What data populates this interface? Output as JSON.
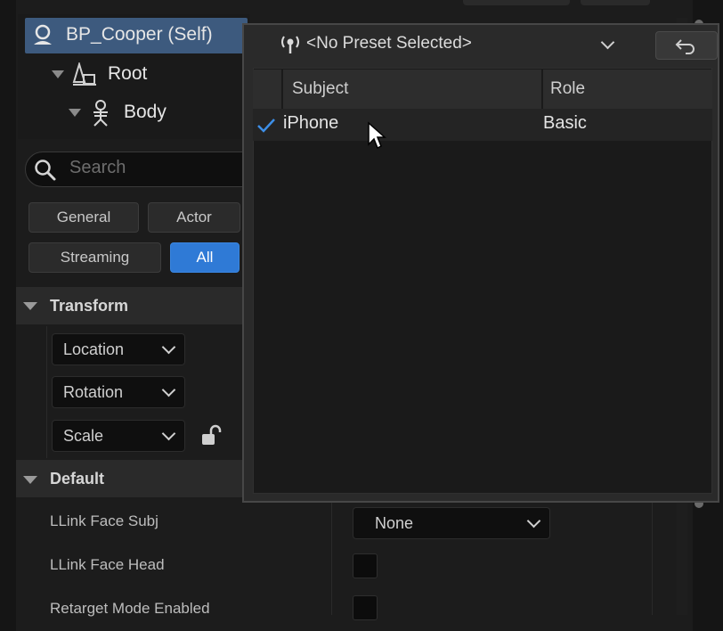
{
  "outliner": {
    "self_item": "BP_Cooper (Self)",
    "root_item": "Root",
    "body_item": "Body"
  },
  "search": {
    "placeholder": "Search"
  },
  "filters": [
    {
      "label": "General",
      "active": false
    },
    {
      "label": "Actor",
      "active": false
    },
    {
      "label": "Streaming",
      "active": false
    },
    {
      "label": "All",
      "active": true
    }
  ],
  "transform": {
    "header": "Transform",
    "location_label": "Location",
    "rotation_label": "Rotation",
    "scale_label": "Scale"
  },
  "default_section": {
    "header": "Default",
    "properties": [
      {
        "label": "LLink Face Subj",
        "value": "None"
      },
      {
        "label": "LLink Face Head",
        "value": ""
      },
      {
        "label": "Retarget Mode Enabled",
        "value": ""
      }
    ]
  },
  "popup": {
    "preset": "<No Preset Selected>",
    "columns": {
      "subject": "Subject",
      "role": "Role"
    },
    "rows": [
      {
        "subject": "iPhone",
        "role": "Basic",
        "checked": true
      }
    ]
  },
  "colors": {
    "selection": "#3d5a7e",
    "accent": "#2f7ad6",
    "check": "#3d8fe8"
  }
}
